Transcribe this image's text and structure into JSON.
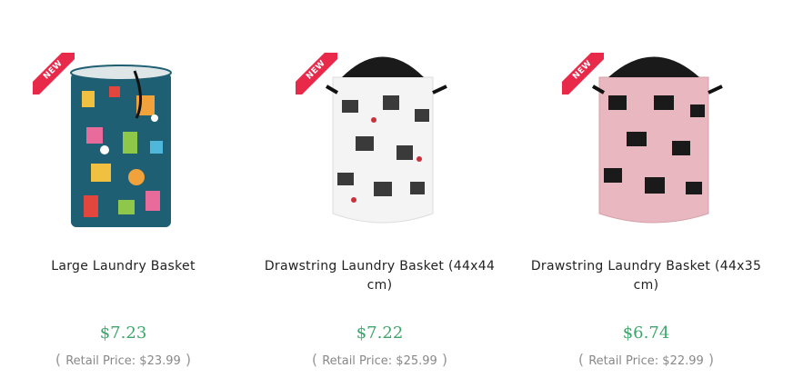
{
  "products": [
    {
      "badge": "NEW",
      "title": "Large Laundry Basket",
      "price": "$7.23",
      "retail_label": "Retail Price:",
      "retail_value": "$23.99",
      "accent": "#1f5f73"
    },
    {
      "badge": "NEW",
      "title": "Drawstring Laundry Basket (44x44cm)",
      "price": "$7.22",
      "retail_label": "Retail Price:",
      "retail_value": "$25.99",
      "accent": "#f4f4f4"
    },
    {
      "badge": "NEW",
      "title": "Drawstring Laundry Basket (44x35cm)",
      "price": "$6.74",
      "retail_label": "Retail Price:",
      "retail_value": "$22.99",
      "accent": "#e8b7bf"
    }
  ],
  "colors": {
    "price": "#3ea66b",
    "ribbon": "#e8294a",
    "retail": "#888888"
  }
}
